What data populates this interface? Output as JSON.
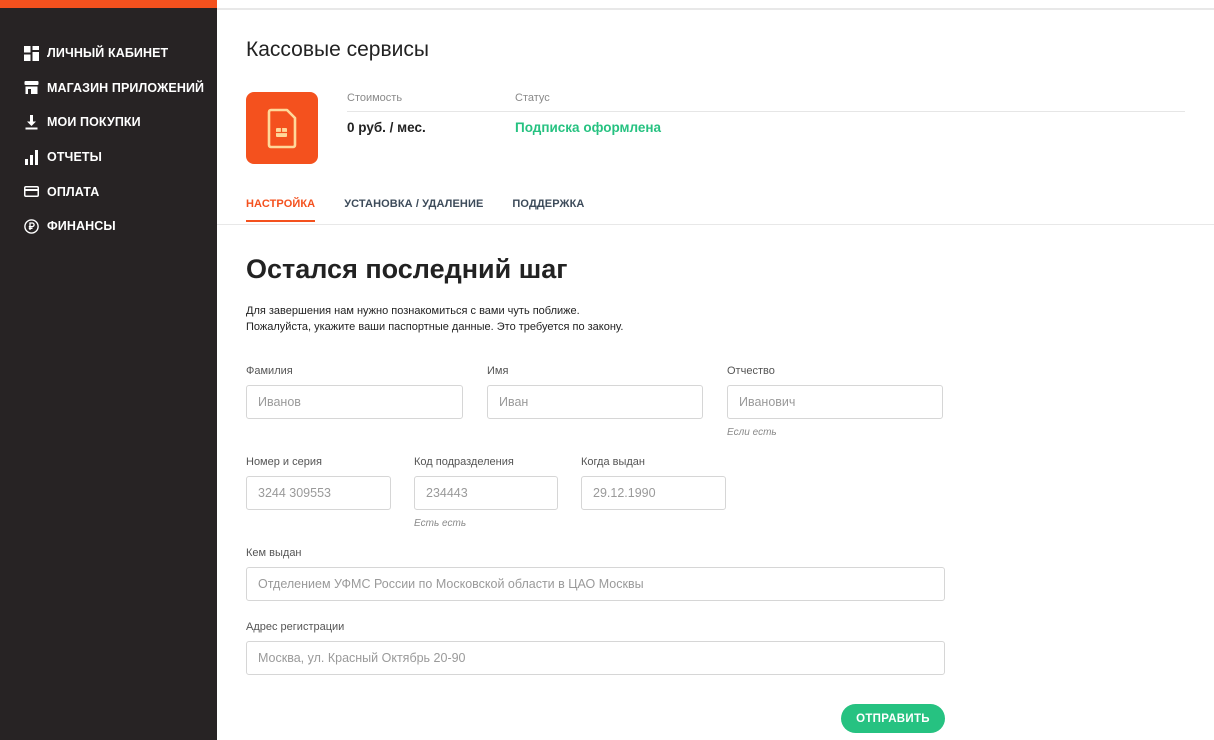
{
  "sidebar": {
    "items": [
      {
        "label": "ЛИЧНЫЙ КАБИНЕТ",
        "icon": "dashboard-icon"
      },
      {
        "label": "МАГАЗИН ПРИЛОЖЕНИЙ",
        "icon": "store-icon"
      },
      {
        "label": "МОИ ПОКУПКИ",
        "icon": "download-icon"
      },
      {
        "label": "ОТЧЕТЫ",
        "icon": "bar-chart-icon"
      },
      {
        "label": "ОПЛАТА",
        "icon": "credit-card-icon"
      },
      {
        "label": "ФИНАНСЫ",
        "icon": "ruble-icon"
      }
    ]
  },
  "app": {
    "title": "Кассовые сервисы",
    "icon": "sim-card-icon",
    "cost_label": "Стоимость",
    "cost_value": "0 руб. / мес.",
    "status_label": "Статус",
    "status_value": "Подписка оформлена"
  },
  "tabs": [
    {
      "label": "НАСТРОЙКА",
      "active": true
    },
    {
      "label": "УСТАНОВКА / УДАЛЕНИЕ",
      "active": false
    },
    {
      "label": "ПОДДЕРЖКА",
      "active": false
    }
  ],
  "form": {
    "heading": "Остался последний шаг",
    "desc_line1": "Для завершения нам нужно познакомиться с вами чуть поближе.",
    "desc_line2": "Пожалуйста, укажите ваши паспортные данные. Это требуется по закону.",
    "last_name": {
      "label": "Фамилия",
      "placeholder": "Иванов"
    },
    "first_name": {
      "label": "Имя",
      "placeholder": "Иван"
    },
    "middle_name": {
      "label": "Отчество",
      "placeholder": "Иванович",
      "hint": "Если есть"
    },
    "passport_number": {
      "label": "Номер и серия",
      "placeholder": "3244 309553"
    },
    "division_code": {
      "label": "Код подразделения",
      "placeholder": "234443",
      "hint": "Есть есть"
    },
    "issue_date": {
      "label": "Когда выдан",
      "placeholder": "29.12.1990"
    },
    "issued_by": {
      "label": "Кем выдан",
      "placeholder": "Отделением УФМС России по Московской области в ЦАО Москвы"
    },
    "address": {
      "label": "Адрес регистрации",
      "placeholder": "Москва, ул. Красный Октябрь 20-90"
    },
    "submit_label": "ОТПРАВИТЬ"
  },
  "colors": {
    "accent": "#f4511e",
    "sidebar_bg": "#272324",
    "success": "#26c281"
  }
}
